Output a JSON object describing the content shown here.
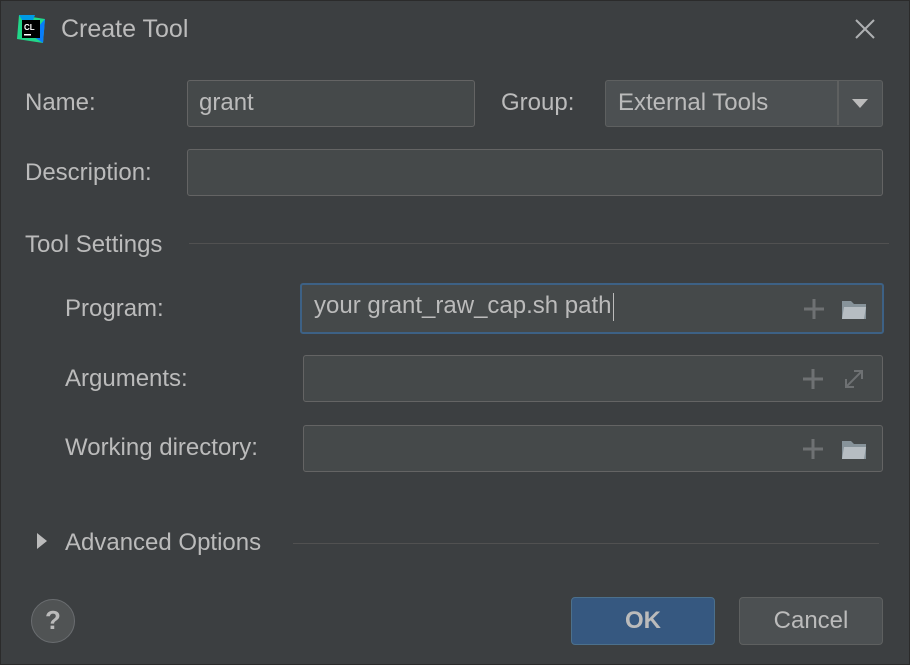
{
  "window": {
    "title": "Create Tool",
    "app_icon_text": "CL"
  },
  "form": {
    "name_label": "Name:",
    "name_value": "grant",
    "group_label": "Group:",
    "group_value": "External Tools",
    "description_label": "Description:",
    "description_value": ""
  },
  "tool_settings": {
    "section_label": "Tool Settings",
    "program_label": "Program:",
    "program_value": "your grant_raw_cap.sh path",
    "arguments_label": "Arguments:",
    "arguments_value": "",
    "working_directory_label": "Working directory:",
    "working_directory_value": ""
  },
  "advanced": {
    "label": "Advanced Options"
  },
  "buttons": {
    "help_label": "?",
    "ok_label": "OK",
    "cancel_label": "Cancel"
  },
  "icons": {
    "app": "clion-icon",
    "close": "close-icon",
    "dropdown": "chevron-down-icon",
    "insert_macro": "plus-icon",
    "browse": "folder-icon",
    "expand": "expand-icon",
    "expand_section": "triangle-right-icon"
  },
  "colors": {
    "accent": "#365880",
    "focus_border": "#3d6185",
    "background": "#3c3f41"
  }
}
